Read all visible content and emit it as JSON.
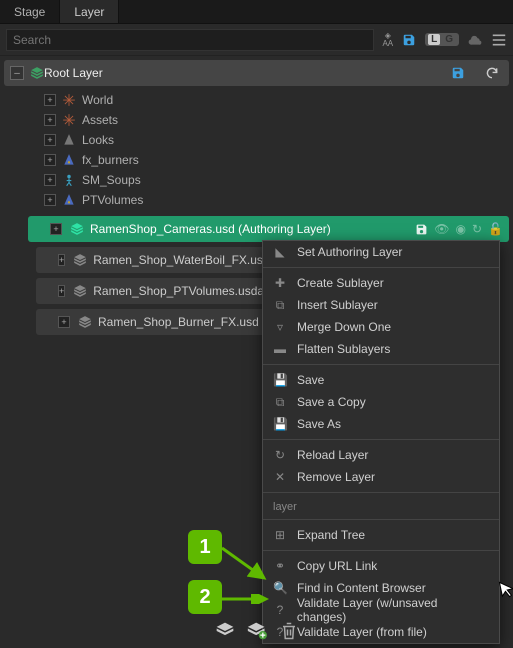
{
  "tabs": {
    "stage": "Stage",
    "layer": "Layer"
  },
  "search_placeholder": "Search",
  "toolbar": {
    "aa1": "◆",
    "aa2": "AA"
  },
  "root": {
    "label": "Root Layer",
    "children": [
      {
        "icon": "xform",
        "label": "World"
      },
      {
        "icon": "xform",
        "label": "Assets"
      },
      {
        "icon": "look",
        "label": "Looks"
      },
      {
        "icon": "prop",
        "label": "fx_burners"
      },
      {
        "icon": "char",
        "label": "SM_Soups"
      },
      {
        "icon": "prop",
        "label": "PTVolumes"
      }
    ]
  },
  "sublayers": {
    "selected": {
      "label": "RamenShop_Cameras.usd (Authoring Layer)"
    },
    "items": [
      {
        "label": "Ramen_Shop_WaterBoil_FX.usd"
      },
      {
        "label": "Ramen_Shop_PTVolumes.usda"
      },
      {
        "label": "Ramen_Shop_Burner_FX.usd"
      }
    ]
  },
  "ctx": {
    "set_authoring": "Set Authoring Layer",
    "create_sub": "Create Sublayer",
    "insert_sub": "Insert Sublayer",
    "merge_down": "Merge Down One",
    "flatten": "Flatten Sublayers",
    "save": "Save",
    "save_copy": "Save a Copy",
    "save_as": "Save As",
    "reload": "Reload Layer",
    "remove": "Remove Layer",
    "header": "layer",
    "expand_tree": "Expand Tree",
    "copy_url": "Copy URL Link",
    "find_cb": "Find in Content Browser",
    "validate_unsaved": "Validate Layer (w/unsaved changes)",
    "validate_file": "Validate Layer (from file)"
  },
  "annotations": {
    "one": "1",
    "two": "2"
  }
}
